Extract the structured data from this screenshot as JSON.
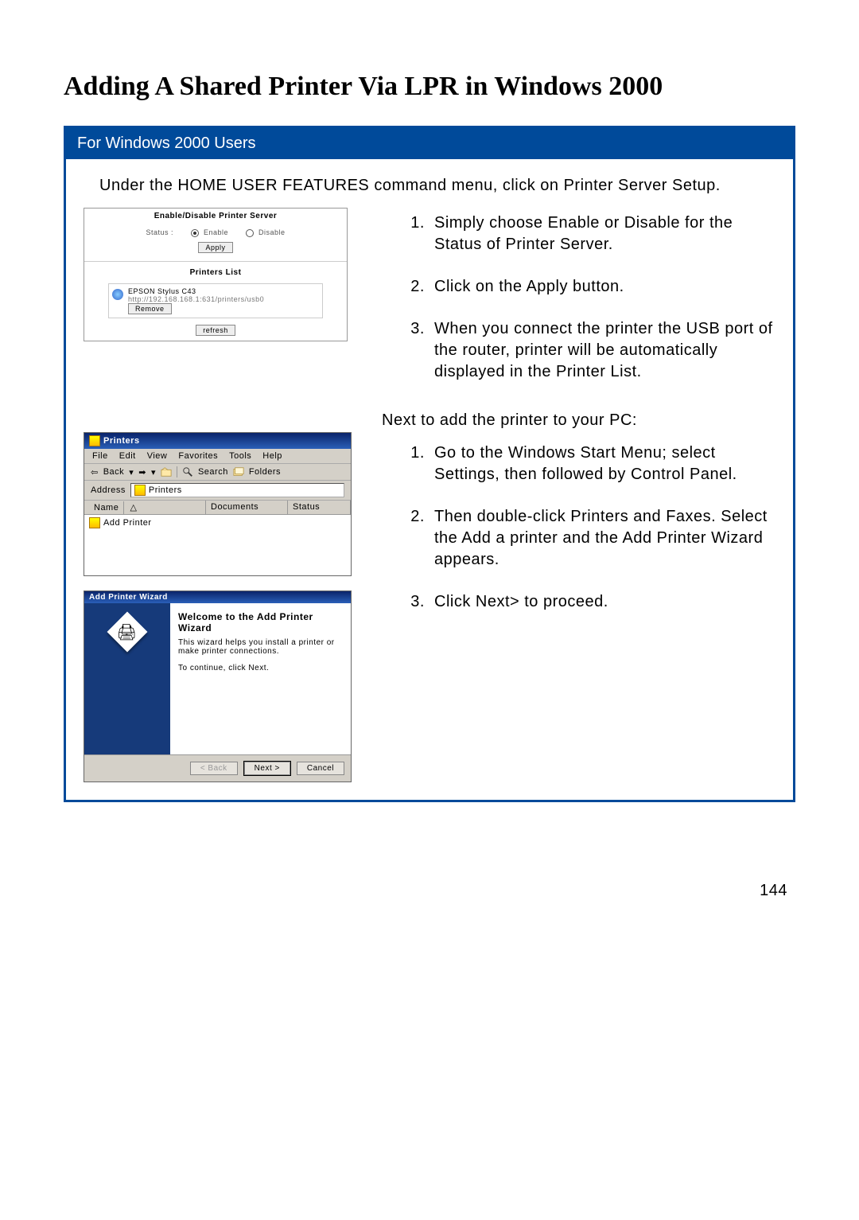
{
  "page_title": "Adding A Shared Printer Via LPR in Windows 2000",
  "page_number": "144",
  "sections": [
    {
      "bar_title": "For Windows 2000 Users",
      "intro": "Under the HOME USER FEATURES command menu, click on Printer Server Setup.",
      "steps_a": [
        "Simply choose Enable or Disable for the Status of Printer Server.",
        "Click on the Apply button.",
        "When you connect the printer the USB port of the router, printer will be automatically displayed in the Printer List."
      ],
      "sub_intro": "Next to add the printer to your PC:",
      "steps_b": [
        "Go to the Windows Start Menu; select Settings, then followed by Control Panel.",
        "Then double-click Printers and Faxes. Select the Add a printer and the Add Printer Wizard appears.",
        "Click Next> to proceed."
      ]
    }
  ],
  "shot1": {
    "hdr1": "Enable/Disable Printer Server",
    "status_label": "Status :",
    "opt_enable": "Enable",
    "opt_disable": "Disable",
    "btn_apply": "Apply",
    "hdr2": "Printers List",
    "printer_name": "EPSON Stylus C43",
    "printer_url": "http://192.168.168.1:631/printers/usb0",
    "btn_remove": "Remove",
    "btn_refresh": "refresh"
  },
  "shot2": {
    "window_title": "Printers",
    "menus": [
      "File",
      "Edit",
      "View",
      "Favorites",
      "Tools",
      "Help"
    ],
    "tb_back": "Back",
    "tb_search": "Search",
    "tb_folders": "Folders",
    "addr_label": "Address",
    "addr_value": "Printers",
    "col_name": "Name",
    "col_docs": "Documents",
    "col_status": "Status",
    "item_add_printer": "Add Printer"
  },
  "shot3": {
    "window_title": "Add Printer Wizard",
    "wiz_title": "Welcome to the Add Printer Wizard",
    "wiz_line1": "This wizard helps you install a printer or make printer connections.",
    "wiz_line2": "To continue, click Next.",
    "btn_back": "< Back",
    "btn_next": "Next >",
    "btn_cancel": "Cancel"
  }
}
